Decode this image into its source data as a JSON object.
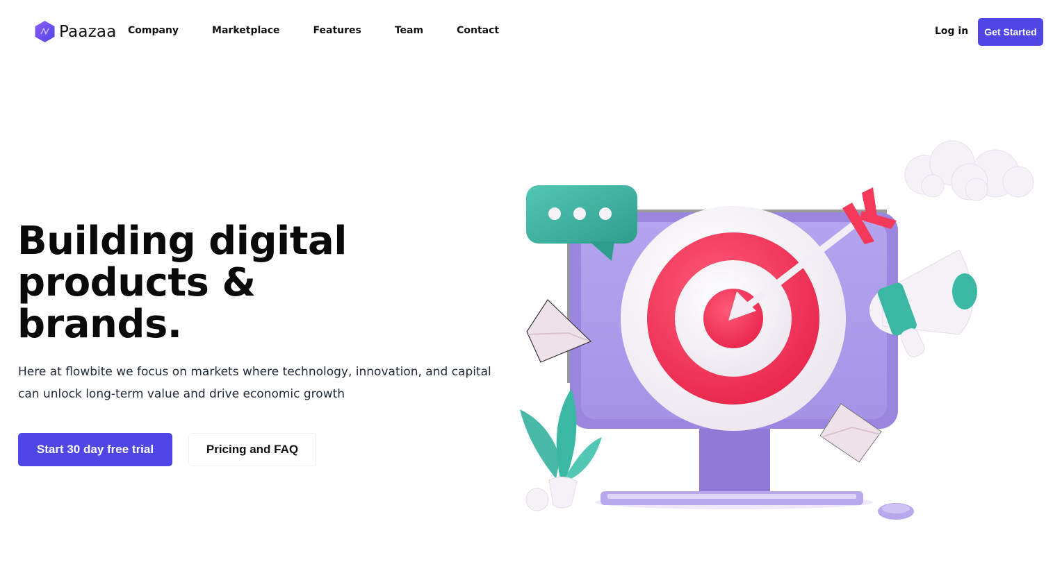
{
  "brand": {
    "name": "Paazaa",
    "logo_icon": "hexagon-logo-icon"
  },
  "nav": {
    "links": [
      "Company",
      "Marketplace",
      "Features",
      "Team",
      "Contact"
    ],
    "login": "Log in",
    "cta": "Get Started"
  },
  "hero": {
    "headline_line1": "Building digital",
    "headline_line2": "products &",
    "headline_line3": "brands.",
    "description": "Here at flowbite we focus on markets where technology, innovation, and capital can unlock long-term value and drive economic growth",
    "primary_button": "Start 30 day free trial",
    "secondary_button": "Pricing and FAQ"
  },
  "illustration": {
    "subject": "monitor-with-target-illustration",
    "icons": [
      "chat-bubble-icon",
      "target-icon",
      "arrow-icon",
      "megaphone-icon",
      "envelope-icon",
      "cloud-icon",
      "plant-icon",
      "keyboard-icon",
      "mouse-icon"
    ]
  },
  "colors": {
    "accent": "#4f46e5",
    "monitor": "#9f8fe6",
    "target_red": "#f4395a",
    "teal": "#3bb8a3"
  }
}
